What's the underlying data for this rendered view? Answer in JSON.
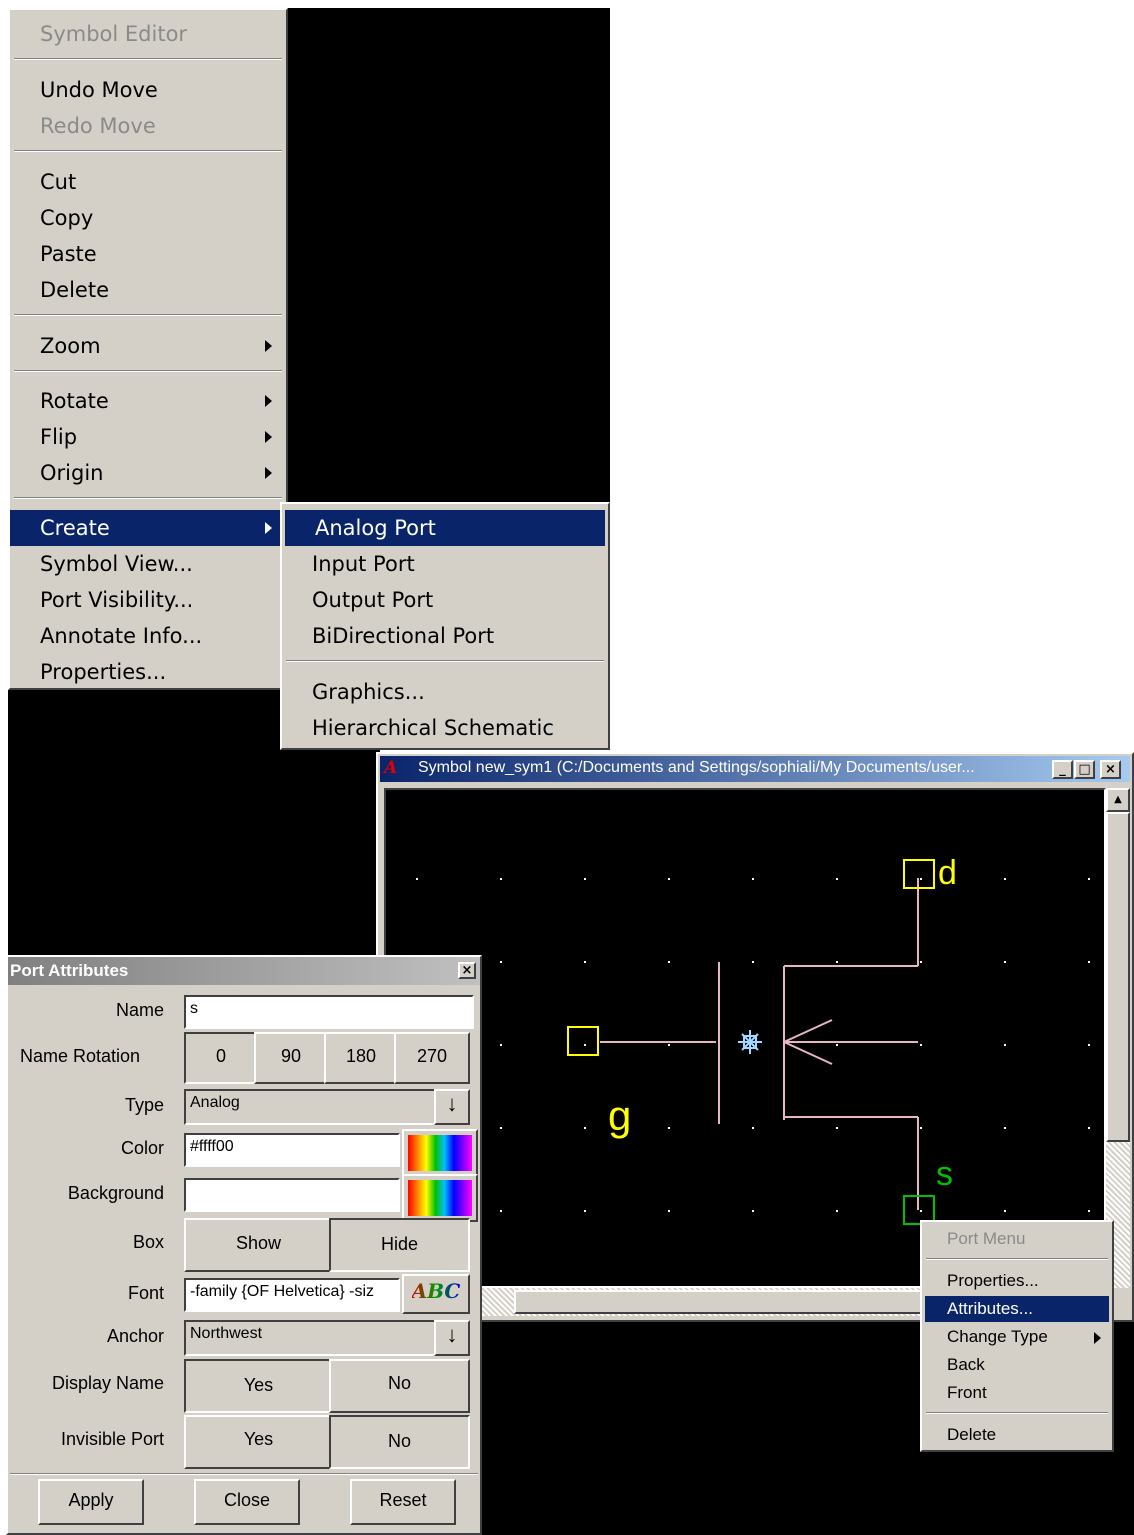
{
  "context_menu": {
    "header": "Symbol Editor",
    "groups": [
      [
        {
          "label": "Undo Move",
          "enabled": true
        },
        {
          "label": "Redo Move",
          "enabled": false
        }
      ],
      [
        {
          "label": "Cut"
        },
        {
          "label": "Copy"
        },
        {
          "label": "Paste"
        },
        {
          "label": "Delete"
        }
      ],
      [
        {
          "label": "Zoom",
          "submenu": true
        }
      ],
      [
        {
          "label": "Rotate",
          "submenu": true
        },
        {
          "label": "Flip",
          "submenu": true
        },
        {
          "label": "Origin",
          "submenu": true
        }
      ],
      [
        {
          "label": "Create",
          "submenu": true,
          "selected": true
        },
        {
          "label": "Symbol View..."
        },
        {
          "label": "Port Visibility..."
        },
        {
          "label": "Annotate Info..."
        },
        {
          "label": "Properties..."
        }
      ]
    ]
  },
  "create_submenu": {
    "items": [
      "Analog Port",
      "Input Port",
      "Output Port",
      "BiDirectional Port"
    ],
    "items2": [
      "Graphics...",
      "Hierarchical Schematic"
    ],
    "selected": "Analog Port"
  },
  "symbol_window": {
    "app_icon": "A",
    "title": "Symbol new_sym1 (C:/Documents and Settings/sophiali/My Documents/user...",
    "controls": {
      "minimize": "_",
      "maximize": "□",
      "close": "×"
    },
    "labels": {
      "d": "d",
      "g": "g",
      "s": "s"
    },
    "colors": {
      "canvas": "#000000",
      "wire": "#e8b4c8",
      "port_box": "#ffff00",
      "selected_port": "#00c000",
      "label_yellow": "#ffff00",
      "label_green": "#00c000",
      "origin": "#a0d8ff"
    }
  },
  "port_menu": {
    "header": "Port Menu",
    "items": [
      {
        "label": "Properties..."
      },
      {
        "label": "Attributes...",
        "selected": true
      },
      {
        "label": "Change Type",
        "submenu": true
      },
      {
        "label": "Back"
      },
      {
        "label": "Front"
      }
    ],
    "last": "Delete"
  },
  "port_attributes": {
    "title": "Port Attributes",
    "close": "×",
    "name_label": "Name",
    "name_value": "s",
    "rotation_label": "Name Rotation",
    "rotations": [
      "0",
      "90",
      "180",
      "270"
    ],
    "rotation_selected": "0",
    "type_label": "Type",
    "type_value": "Analog",
    "color_label": "Color",
    "color_value": "#ffff00",
    "background_label": "Background",
    "background_value": "",
    "box_label": "Box",
    "box_options": [
      "Show",
      "Hide"
    ],
    "box_selected": "Hide",
    "font_label": "Font",
    "font_value": "-family {OF Helvetica} -siz",
    "font_button": "ABC",
    "anchor_label": "Anchor",
    "anchor_value": "Northwest",
    "display_name_label": "Display Name",
    "display_name_options": [
      "Yes",
      "No"
    ],
    "display_name_selected": "Yes",
    "invisible_label": "Invisible Port",
    "invisible_options": [
      "Yes",
      "No"
    ],
    "invisible_selected": "No",
    "buttons": {
      "apply": "Apply",
      "close": "Close",
      "reset": "Reset"
    },
    "dropdown_arrow": "↓"
  }
}
